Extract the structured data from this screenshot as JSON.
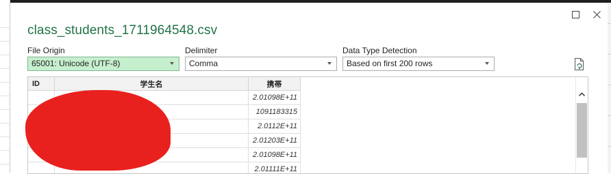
{
  "window": {
    "title": "class_students_1711964548.csv"
  },
  "file_origin": {
    "label": "File Origin",
    "value": "65001: Unicode (UTF-8)"
  },
  "delimiter": {
    "label": "Delimiter",
    "value": "Comma"
  },
  "data_type_detection": {
    "label": "Data Type Detection",
    "value": "Based on first 200 rows"
  },
  "table": {
    "columns": [
      "ID",
      "学生名",
      "携帯"
    ],
    "rows": [
      {
        "id": "",
        "name": "",
        "phone": "2.01098E+11"
      },
      {
        "id": "",
        "name": "",
        "phone": "1091183315"
      },
      {
        "id": "",
        "name": "",
        "phone": "2.0112E+11"
      },
      {
        "id": "",
        "name": "",
        "phone": "2.01203E+11"
      },
      {
        "id": "",
        "name": "",
        "phone": "2.01098E+11"
      },
      {
        "id": "",
        "name": "",
        "phone": "2.01111E+11"
      }
    ]
  },
  "icons": {
    "maximize": "maximize-icon",
    "close": "close-icon",
    "refresh": "refresh-icon"
  },
  "colors": {
    "title": "#217346",
    "selected_dropdown": "#c6efce",
    "redaction": "#e8211f"
  }
}
